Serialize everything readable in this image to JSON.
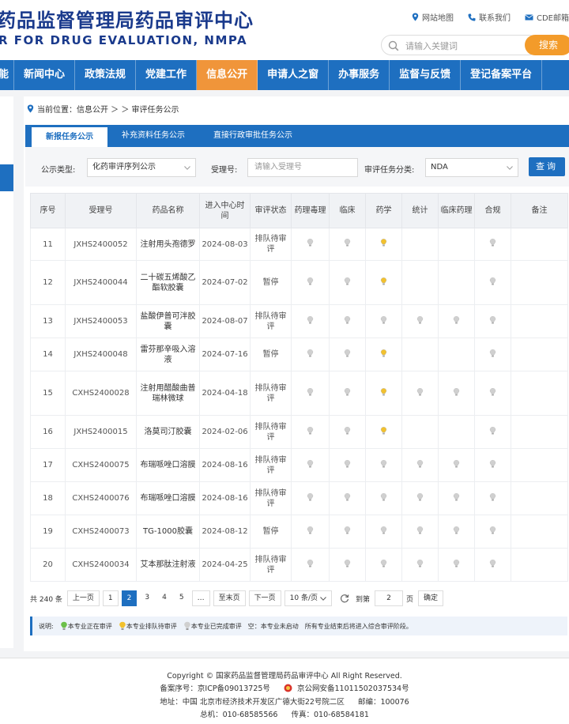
{
  "header": {
    "logo_cn": "药品监督管理局药品审评中心",
    "logo_en": "R FOR DRUG EVALUATION, NMPA",
    "top_links": [
      {
        "label": "网站地图",
        "icon": "location-pin-icon"
      },
      {
        "label": "联系我们",
        "icon": "phone-icon"
      },
      {
        "label": "CDE邮箱",
        "icon": "mail-icon"
      }
    ],
    "search_placeholder": "请输入关键词",
    "search_button": "搜索"
  },
  "nav": {
    "items": [
      "能",
      "新闻中心",
      "政策法规",
      "党建工作",
      "信息公开",
      "申请人之窗",
      "办事服务",
      "监督与反馈",
      "登记备案平台"
    ],
    "active": "信息公开"
  },
  "breadcrumb": "当前位置：信息公开 ＞ ＞ 审评任务公示",
  "tabs": [
    "新报任务公示",
    "补充资料任务公示",
    "直接行政审批任务公示"
  ],
  "filter": {
    "type_label": "公示类型:",
    "type_value": "化药审评序列公示",
    "accept_label": "受理号:",
    "accept_placeholder": "请输入受理号",
    "category_label": "审评任务分类:",
    "category_value": "NDA",
    "query_button": "查询"
  },
  "table": {
    "headers": [
      "序号",
      "受理号",
      "药品名称",
      "进入中心时间",
      "审评状态",
      "药理毒理",
      "临床",
      "药学",
      "统计",
      "临床药理",
      "合规",
      "备注"
    ],
    "rows": [
      {
        "no": "11",
        "id": "JXHS2400052",
        "name": "注射用头孢德罗",
        "date": "2024-08-03",
        "status": "排队待审评",
        "lights": [
          "g",
          "g",
          "y",
          "",
          "",
          "g"
        ]
      },
      {
        "no": "12",
        "id": "JXHS2400044",
        "name": "二十碳五烯酸乙酯软胶囊",
        "date": "2024-07-02",
        "status": "暂停",
        "lights": [
          "g",
          "g",
          "y",
          "",
          "",
          "g"
        ]
      },
      {
        "no": "13",
        "id": "JXHS2400053",
        "name": "盐酸伊普可泮胶囊",
        "date": "2024-08-07",
        "status": "排队待审评",
        "lights": [
          "g",
          "g",
          "g",
          "g",
          "g",
          "g"
        ]
      },
      {
        "no": "14",
        "id": "JXHS2400048",
        "name": "雷芬那辛吸入溶液",
        "date": "2024-07-16",
        "status": "暂停",
        "lights": [
          "g",
          "g",
          "y",
          "",
          "",
          "g"
        ]
      },
      {
        "no": "15",
        "id": "CXHS2400028",
        "name": "注射用醋酸曲普瑞林微球",
        "date": "2024-04-18",
        "status": "排队待审评",
        "lights": [
          "g",
          "g",
          "y",
          "g",
          "g",
          "g"
        ]
      },
      {
        "no": "16",
        "id": "JXHS2400015",
        "name": "洛莫司汀胶囊",
        "date": "2024-02-06",
        "status": "排队待审评",
        "lights": [
          "g",
          "g",
          "y",
          "",
          "",
          "g"
        ]
      },
      {
        "no": "17",
        "id": "CXHS2400075",
        "name": "布瑞哌唑口溶膜",
        "date": "2024-08-16",
        "status": "排队待审评",
        "lights": [
          "g",
          "g",
          "g",
          "g",
          "g",
          "g"
        ]
      },
      {
        "no": "18",
        "id": "CXHS2400076",
        "name": "布瑞哌唑口溶膜",
        "date": "2024-08-16",
        "status": "排队待审评",
        "lights": [
          "g",
          "g",
          "g",
          "g",
          "g",
          "g"
        ]
      },
      {
        "no": "19",
        "id": "CXHS2400073",
        "name": "TG-1000胶囊",
        "date": "2024-08-12",
        "status": "暂停",
        "lights": [
          "g",
          "g",
          "g",
          "g",
          "g",
          "g"
        ]
      },
      {
        "no": "20",
        "id": "CXHS2400034",
        "name": "艾本那肽注射液",
        "date": "2024-04-25",
        "status": "排队待审评",
        "lights": [
          "g",
          "g",
          "g",
          "g",
          "g",
          "g"
        ]
      }
    ]
  },
  "pager": {
    "total": "共 240 条",
    "prev": "上一页",
    "pages": [
      "1",
      "2",
      "3",
      "4",
      "5",
      "…"
    ],
    "current": "2",
    "last": "至末页",
    "next": "下一页",
    "page_size": "10 条/页",
    "goto_label": "到第",
    "goto_value": "2",
    "page_unit": "页",
    "confirm": "确定"
  },
  "legend": {
    "title": "说明:",
    "items": [
      "本专业正在审评",
      "本专业排队待审评",
      "本专业已完成审评",
      "空：本专业未启动",
      "所有专业结束后将进入综合审评阶段。"
    ]
  },
  "footer": {
    "copyright": "Copyright © 国家药品监督管理局药品审评中心  All Right Reserved.",
    "icp": "备案序号：京ICP备09013725号",
    "police": "京公网安备11011502037534号",
    "address": "地址：中国 北京市经济技术开发区广德大街22号院二区",
    "postcode": "邮编：100076",
    "phone": "总机：010-68585566",
    "fax": "传真：010-68584181"
  },
  "colors": {
    "primary": "#1e6fc0",
    "accent": "#f0953a",
    "bulb_pending": "#f2c12e",
    "bulb_done": "#d0d0d0",
    "bulb_active": "#6cc04a"
  }
}
